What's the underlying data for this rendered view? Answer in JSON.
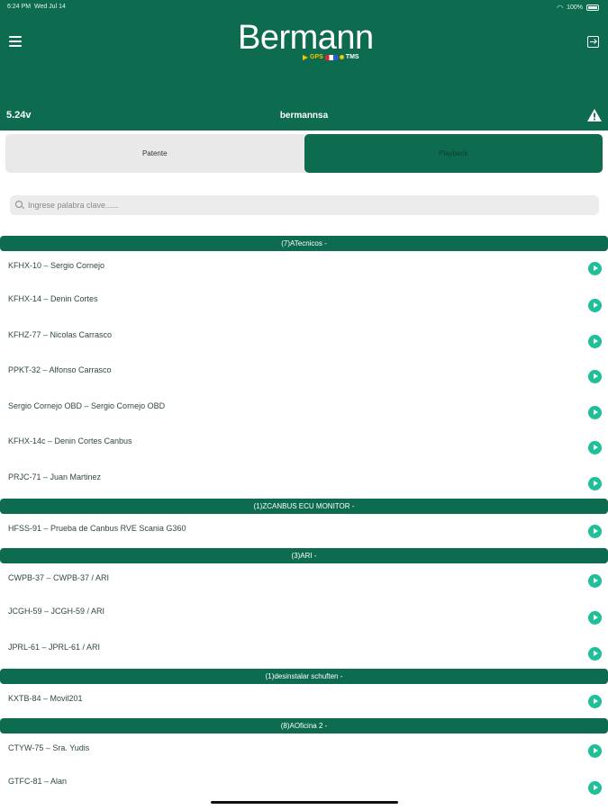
{
  "status": {
    "time": "6:24 PM",
    "date": "Wed Jul 14",
    "battery": "100%"
  },
  "header": {
    "logo_text": "Bermann",
    "logo_sub_gps": "GPS",
    "logo_sub_tms": "TMS",
    "version": "5.24v",
    "username": "bermannsa"
  },
  "tabs": [
    {
      "label": "Patente",
      "active": false
    },
    {
      "label": "Playback",
      "active": true
    }
  ],
  "search": {
    "placeholder": "Ingrese palabra clave......",
    "value": ""
  },
  "groups": [
    {
      "title": "(7)ATecnicos -",
      "items": [
        "KFHX-10 – Sergio Cornejo",
        "KFHX-14 – Denin Cortes",
        "KFHZ-77 – Nicolas Carrasco",
        "PPKT-32 – Alfonso Carrasco",
        "Sergio Cornejo OBD – Sergio Cornejo OBD",
        "KFHX-14c – Denin Cortes Canbus",
        "PRJC-71 – Juan Martinez"
      ]
    },
    {
      "title": "(1)ZCANBUS ECU MONITOR -",
      "items": [
        "HFSS-91 – Prueba de Canbus RVE Scania G360"
      ]
    },
    {
      "title": "(3)ARI -",
      "items": [
        "CWPB-37 – CWPB-37 / ARI",
        "JCGH-59 – JCGH-59 /  ARI",
        "JPRL-61 – JPRL-61 /  ARI"
      ]
    },
    {
      "title": "(1)desinstalar schuften -",
      "items": [
        "KXTB-84 – Movil201"
      ]
    },
    {
      "title": "(8)AOficina 2 -",
      "items": [
        "CTYW-75 – Sra. Yudis",
        "GTFC-81 – Alan"
      ]
    }
  ],
  "colors": {
    "brand_green": "#0d6b4f",
    "play_teal": "#1fbf9a"
  }
}
